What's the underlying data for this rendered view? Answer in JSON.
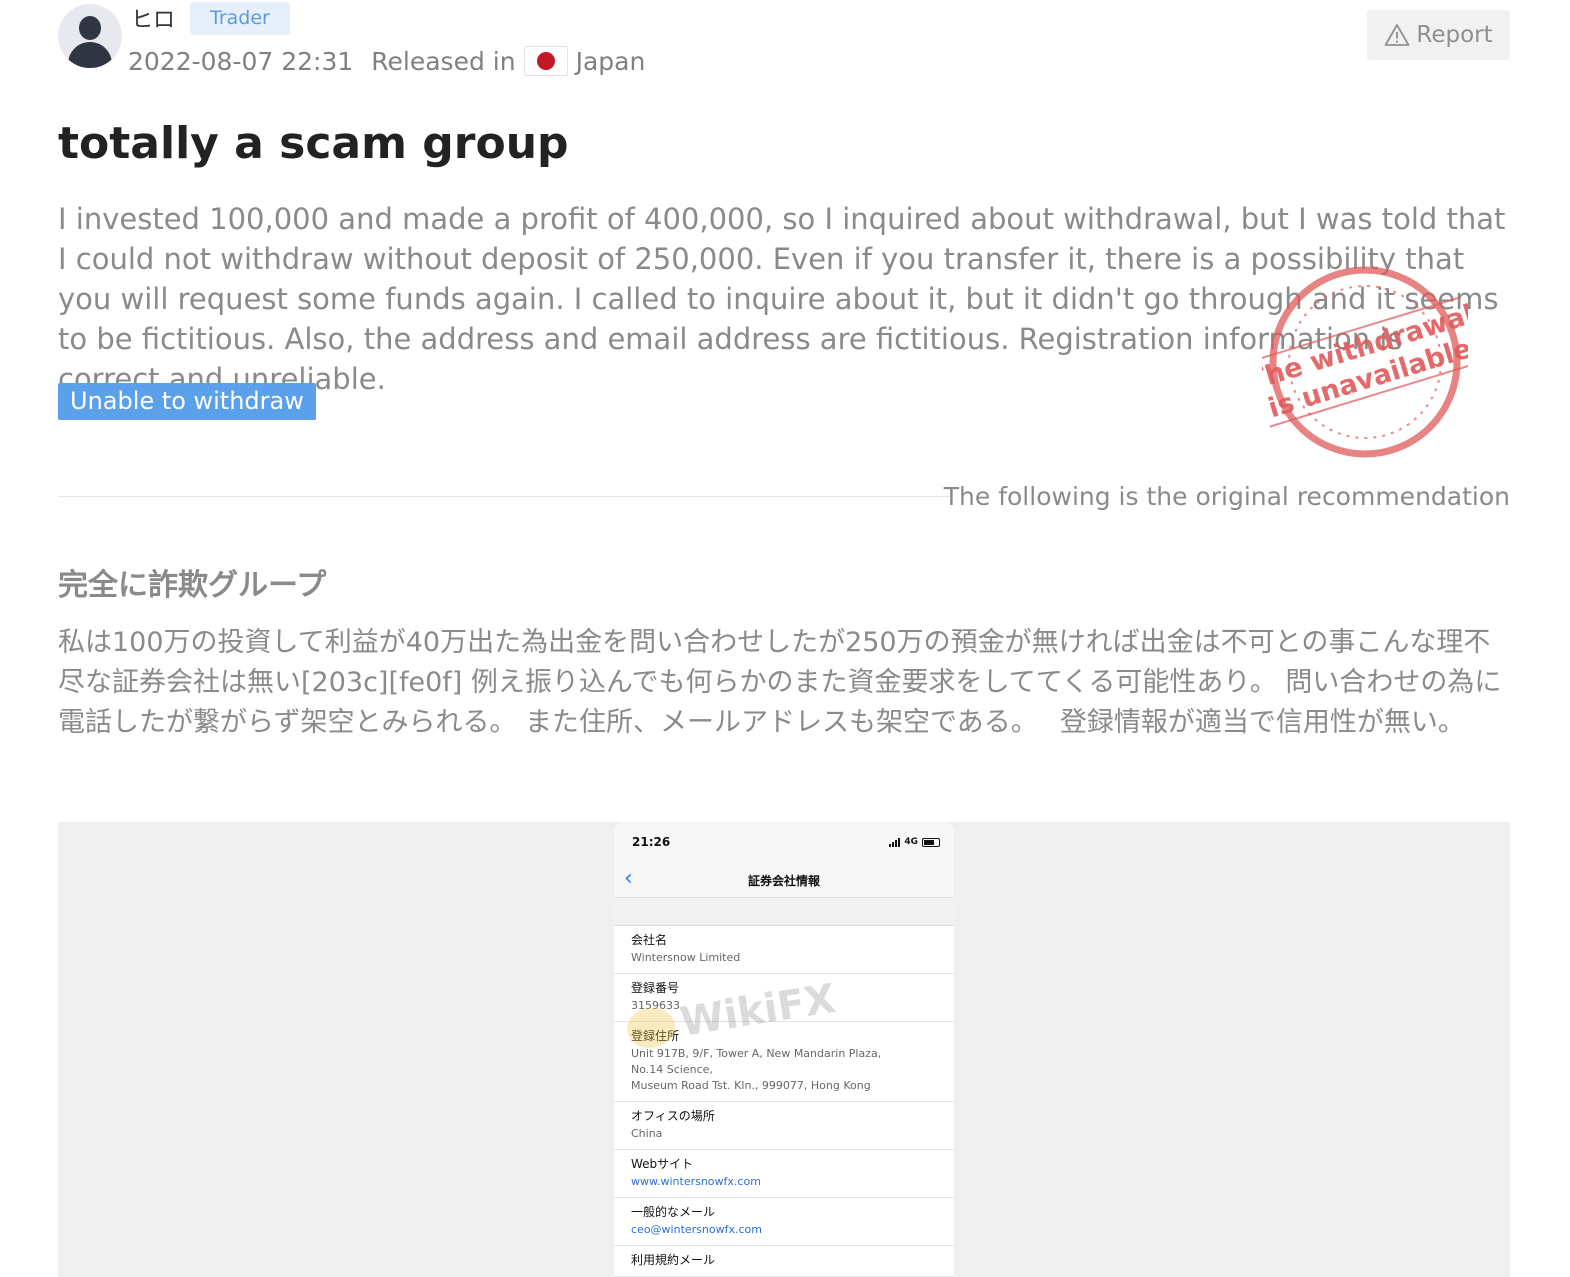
{
  "user": {
    "name": "ヒロ",
    "role": "Trader"
  },
  "meta": {
    "date": "2022-08-07 22:31",
    "released_label": "Released in",
    "country": "Japan"
  },
  "actions": {
    "report_label": "Report"
  },
  "review": {
    "title": "totally a scam group",
    "body": "I invested 100,000 and made a profit of 400,000, so I inquired about withdrawal, but I was told that I could not withdraw without deposit of 250,000.  Even if you transfer it, there is a possibility that you will request some funds again. I called to inquire about it, but it didn't go through and it seems to be fictitious. Also, the address and email address are fictitious. Registration information is correct and unreliable.",
    "tag": "Unable to withdraw"
  },
  "stamp": {
    "line1": "The withdrawal",
    "line2": "is unavailable"
  },
  "original": {
    "label": "The following is the original recommendation",
    "title": "完全に詐欺グループ",
    "body": "私は100万の投資して利益が40万出た為出金を問い合わせしたが250万の預金が無ければ出金は不可との事こんな理不尽な証券会社は無い[203c][fe0f] 例え振り込んでも何らかのまた資金要求をしててくる可能性あり。 問い合わせの為に電話したが繋がらず架空とみられる。 また住所、メールアドレスも架空である。　 登録情報が適当で信用性が無い。"
  },
  "screenshot": {
    "time": "21:26",
    "network": "4G",
    "nav_title": "証券会社情報",
    "watermark": "WikiFX",
    "rows": [
      {
        "label": "会社名",
        "value": "Wintersnow Limited"
      },
      {
        "label": "登録番号",
        "value": "3159633"
      },
      {
        "label": "登録住所",
        "value_lines": [
          "Unit 917B, 9/F, Tower A, New Mandarin Plaza,",
          "No.14 Science,",
          "Museum Road Tst. Kln., 999077, Hong Kong"
        ]
      },
      {
        "label": "オフィスの場所",
        "value": "China"
      },
      {
        "label": "Webサイト",
        "value": "www.wintersnowfx.com"
      },
      {
        "label": "一般的なメール",
        "value": "ceo@wintersnowfx.com"
      },
      {
        "label": "利用規約メール"
      }
    ]
  },
  "colors": {
    "accent": "#5aa0ea",
    "stamp": "#e05a5a",
    "link": "#2b6fd6"
  }
}
